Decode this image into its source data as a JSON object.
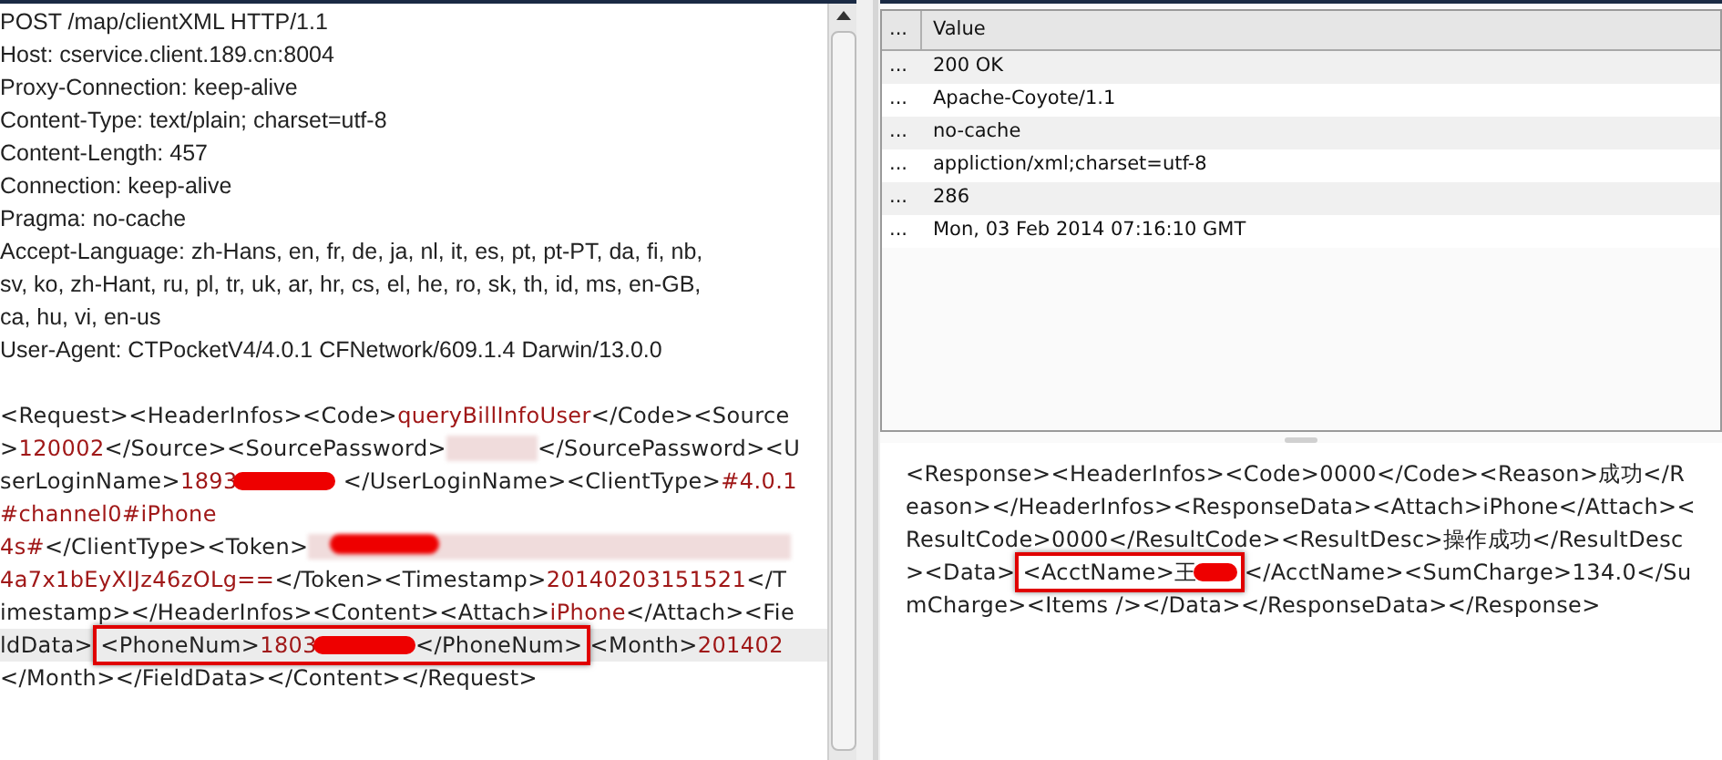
{
  "request": {
    "header_lines": [
      "POST /map/clientXML HTTP/1.1",
      "Host: cservice.client.189.cn:8004",
      "Proxy-Connection: keep-alive",
      "Content-Type: text/plain; charset=utf-8",
      "Content-Length: 457",
      "Connection: keep-alive",
      "Pragma: no-cache",
      "Accept-Language: zh-Hans, en, fr, de, ja, nl, it, es, pt, pt-PT, da, fi, nb,",
      "sv, ko, zh-Hant, ru, pl, tr, uk, ar, hr, cs, el, he, ro, sk, th, id, ms, en-GB,",
      "ca, hu, vi, en-us",
      "User-Agent: CTPocketV4/4.0.1 CFNetwork/609.1.4 Darwin/13.0.0"
    ],
    "body_lines": [
      {
        "current": false,
        "segments": [
          {
            "kind": "tag",
            "text": "<Request><HeaderInfos><Code>"
          },
          {
            "kind": "value",
            "text": "queryBillInfoUser"
          },
          {
            "kind": "tag",
            "text": "</Code><Source"
          }
        ]
      },
      {
        "current": false,
        "segments": [
          {
            "kind": "tag",
            "text": ">"
          },
          {
            "kind": "value",
            "text": "120002"
          },
          {
            "kind": "tag",
            "text": "</Source><SourcePassword>"
          },
          {
            "kind": "blur"
          },
          {
            "kind": "tag",
            "text": "</SourcePassword><U"
          }
        ]
      },
      {
        "current": false,
        "segments": [
          {
            "kind": "tag",
            "text": "serLoginName>"
          },
          {
            "kind": "value",
            "text": "1893"
          },
          {
            "kind": "scribble"
          },
          {
            "kind": "tag",
            "text": " </UserLoginName><ClientType>"
          },
          {
            "kind": "value",
            "text": "#4.0.1"
          }
        ]
      },
      {
        "current": false,
        "segments": [
          {
            "kind": "value",
            "text": "#channel0#iPhone"
          }
        ]
      },
      {
        "current": false,
        "segments": [
          {
            "kind": "value",
            "text": "4s#"
          },
          {
            "kind": "tag",
            "text": "</ClientType><Token>"
          },
          {
            "kind": "scribbled-blur"
          }
        ]
      },
      {
        "current": false,
        "segments": [
          {
            "kind": "value",
            "text": "4a7x1bEyXIJz46zOLg=="
          },
          {
            "kind": "tag",
            "text": "</Token><Timestamp>"
          },
          {
            "kind": "value",
            "text": "20140203151521"
          },
          {
            "kind": "tag",
            "text": "</T"
          }
        ]
      },
      {
        "current": false,
        "segments": [
          {
            "kind": "tag",
            "text": "imestamp></HeaderInfos><Content><Attach>"
          },
          {
            "kind": "value",
            "text": "iPhone"
          },
          {
            "kind": "tag",
            "text": "</Attach><Fie"
          }
        ]
      },
      {
        "current": true,
        "segments": [
          {
            "kind": "tag",
            "text": "ldData>"
          },
          {
            "kind": "box",
            "segments": [
              {
                "kind": "tag",
                "text": "<PhoneNum>"
              },
              {
                "kind": "value",
                "text": "1803"
              },
              {
                "kind": "scribble"
              },
              {
                "kind": "tag",
                "text": "</PhoneNum>"
              }
            ]
          },
          {
            "kind": "tag",
            "text": "<Month>"
          },
          {
            "kind": "value",
            "text": "201402"
          }
        ]
      },
      {
        "current": false,
        "segments": [
          {
            "kind": "tag",
            "text": "</Month></FieldData></Content></Request>"
          }
        ]
      }
    ]
  },
  "response": {
    "table": {
      "columns": [
        "...",
        "Value"
      ],
      "rows": [
        [
          "...",
          "200 OK"
        ],
        [
          "...",
          "Apache-Coyote/1.1"
        ],
        [
          "...",
          "no-cache"
        ],
        [
          "...",
          "appliction/xml;charset=utf-8"
        ],
        [
          "...",
          "286"
        ],
        [
          "...",
          "Mon, 03 Feb 2014 07:16:10 GMT"
        ]
      ]
    },
    "body_lines": [
      {
        "current": false,
        "segments": [
          {
            "kind": "tag",
            "text": "<Response><HeaderInfos><Code>0000</Code><Reason>成功</R"
          }
        ]
      },
      {
        "current": false,
        "segments": [
          {
            "kind": "tag",
            "text": "eason></HeaderInfos><ResponseData><Attach>iPhone</Attach><"
          }
        ]
      },
      {
        "current": false,
        "segments": [
          {
            "kind": "tag",
            "text": "ResultCode>0000</ResultCode><ResultDesc>操作成功</ResultDesc"
          }
        ]
      },
      {
        "current": false,
        "segments": [
          {
            "kind": "tag",
            "text": "><Data>"
          },
          {
            "kind": "box",
            "segments": [
              {
                "kind": "tag",
                "text": "<AcctName>王"
              },
              {
                "kind": "scribble"
              }
            ]
          },
          {
            "kind": "tag",
            "text": "</AcctName><SumCharge>134.0</Su"
          }
        ]
      },
      {
        "current": false,
        "segments": [
          {
            "kind": "tag",
            "text": "mCharge><Items /></Data></ResponseData></Response>"
          }
        ]
      }
    ]
  }
}
